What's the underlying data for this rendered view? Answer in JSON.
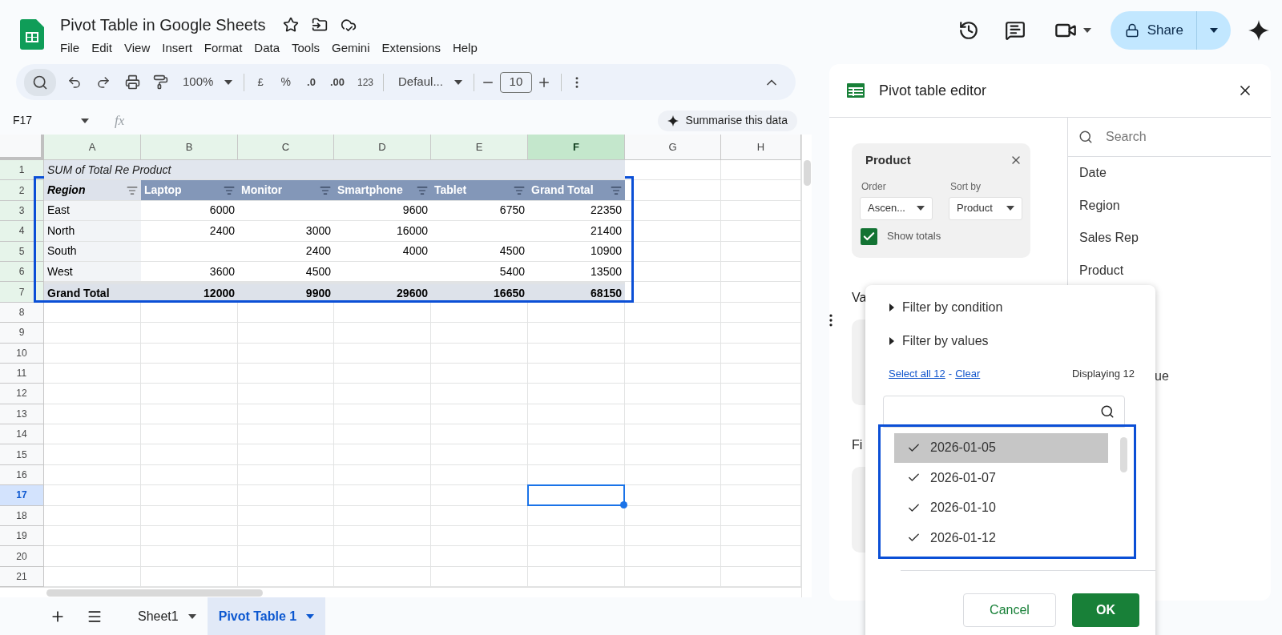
{
  "document": {
    "title": "Pivot Table in Google Sheets",
    "menu": [
      "File",
      "Edit",
      "View",
      "Insert",
      "Format",
      "Data",
      "Tools",
      "Gemini",
      "Extensions",
      "Help"
    ]
  },
  "share": {
    "label": "Share"
  },
  "toolbar": {
    "zoom": "100%",
    "currency": "£",
    "percent": "%",
    "decrease_decimals": ".0",
    "increase_decimals": ".00",
    "number_format": "123",
    "font": "Defaul...",
    "font_size": "10"
  },
  "formula_bar": {
    "cell_ref": "F17",
    "fx": "fx",
    "summarise": "Summarise this data"
  },
  "columns": [
    {
      "label": "A",
      "highlighted": true,
      "selected": false
    },
    {
      "label": "B",
      "highlighted": true,
      "selected": false
    },
    {
      "label": "C",
      "highlighted": true,
      "selected": false
    },
    {
      "label": "D",
      "highlighted": true,
      "selected": false
    },
    {
      "label": "E",
      "highlighted": true,
      "selected": false
    },
    {
      "label": "F",
      "highlighted": true,
      "selected": true
    },
    {
      "label": "G",
      "highlighted": false,
      "selected": false
    },
    {
      "label": "H",
      "highlighted": false,
      "selected": false
    }
  ],
  "rows": [
    {
      "label": "1",
      "highlighted": true,
      "selected": false
    },
    {
      "label": "2",
      "highlighted": true,
      "selected": false
    },
    {
      "label": "3",
      "highlighted": true,
      "selected": false
    },
    {
      "label": "4",
      "highlighted": true,
      "selected": false
    },
    {
      "label": "5",
      "highlighted": true,
      "selected": false
    },
    {
      "label": "6",
      "highlighted": true,
      "selected": false
    },
    {
      "label": "7",
      "highlighted": true,
      "selected": false
    },
    {
      "label": "8",
      "highlighted": false,
      "selected": false
    },
    {
      "label": "9",
      "highlighted": false,
      "selected": false
    },
    {
      "label": "10",
      "highlighted": false,
      "selected": false
    },
    {
      "label": "11",
      "highlighted": false,
      "selected": false
    },
    {
      "label": "12",
      "highlighted": false,
      "selected": false
    },
    {
      "label": "13",
      "highlighted": false,
      "selected": false
    },
    {
      "label": "14",
      "highlighted": false,
      "selected": false
    },
    {
      "label": "15",
      "highlighted": false,
      "selected": false
    },
    {
      "label": "16",
      "highlighted": false,
      "selected": false
    },
    {
      "label": "17",
      "highlighted": false,
      "selected": true
    },
    {
      "label": "18",
      "highlighted": false,
      "selected": false
    },
    {
      "label": "19",
      "highlighted": false,
      "selected": false
    },
    {
      "label": "20",
      "highlighted": false,
      "selected": false
    },
    {
      "label": "21",
      "highlighted": false,
      "selected": false
    }
  ],
  "pivot": {
    "rows": [
      {
        "kind": "title",
        "cells": [
          "SUM of Total Re Product"
        ]
      },
      {
        "kind": "header",
        "cells": [
          "Region",
          "Laptop",
          "Monitor",
          "Smartphone",
          "Tablet",
          "Grand Total"
        ]
      },
      {
        "kind": "body",
        "cells": [
          "East",
          "6000",
          null,
          "9600",
          "6750",
          "22350"
        ]
      },
      {
        "kind": "body",
        "cells": [
          "North",
          "2400",
          "3000",
          "16000",
          null,
          "21400"
        ]
      },
      {
        "kind": "body",
        "cells": [
          "South",
          null,
          "2400",
          "4000",
          "4500",
          "10900"
        ]
      },
      {
        "kind": "body",
        "cells": [
          "West",
          "3600",
          "4500",
          null,
          "5400",
          "13500"
        ]
      },
      {
        "kind": "total",
        "cells": [
          "Grand Total",
          "12000",
          "9900",
          "29600",
          "16650",
          "68150"
        ]
      }
    ]
  },
  "sheet_tabs": [
    {
      "label": "Sheet1",
      "selected": false
    },
    {
      "label": "Pivot Table 1",
      "selected": true
    }
  ],
  "editor": {
    "title": "Pivot table editor",
    "card": {
      "title": "Product",
      "order_label": "Order",
      "order_value": "Ascen...",
      "sort_label": "Sort by",
      "sort_value": "Product",
      "show_totals": "Show totals",
      "checked": true
    },
    "cut_labels": [
      "Va",
      "Fi"
    ],
    "search_placeholder": "Search",
    "fields": [
      "Date",
      "Region",
      "Sales Rep",
      "Product"
    ],
    "cut_field": "ue"
  },
  "filter_popup": {
    "sections": [
      {
        "label": "Filter by condition",
        "expanded": false
      },
      {
        "label": "Filter by values",
        "expanded": false
      }
    ],
    "select_all": "Select all 12",
    "separator": "-",
    "clear": "Clear",
    "displaying": "Displaying 12",
    "values": [
      {
        "label": "2026-01-05",
        "checked": true,
        "selected": true
      },
      {
        "label": "2026-01-07",
        "checked": true,
        "selected": false
      },
      {
        "label": "2026-01-10",
        "checked": true,
        "selected": false
      },
      {
        "label": "2026-01-12",
        "checked": true,
        "selected": false
      }
    ],
    "cancel": "Cancel",
    "ok": "OK"
  }
}
